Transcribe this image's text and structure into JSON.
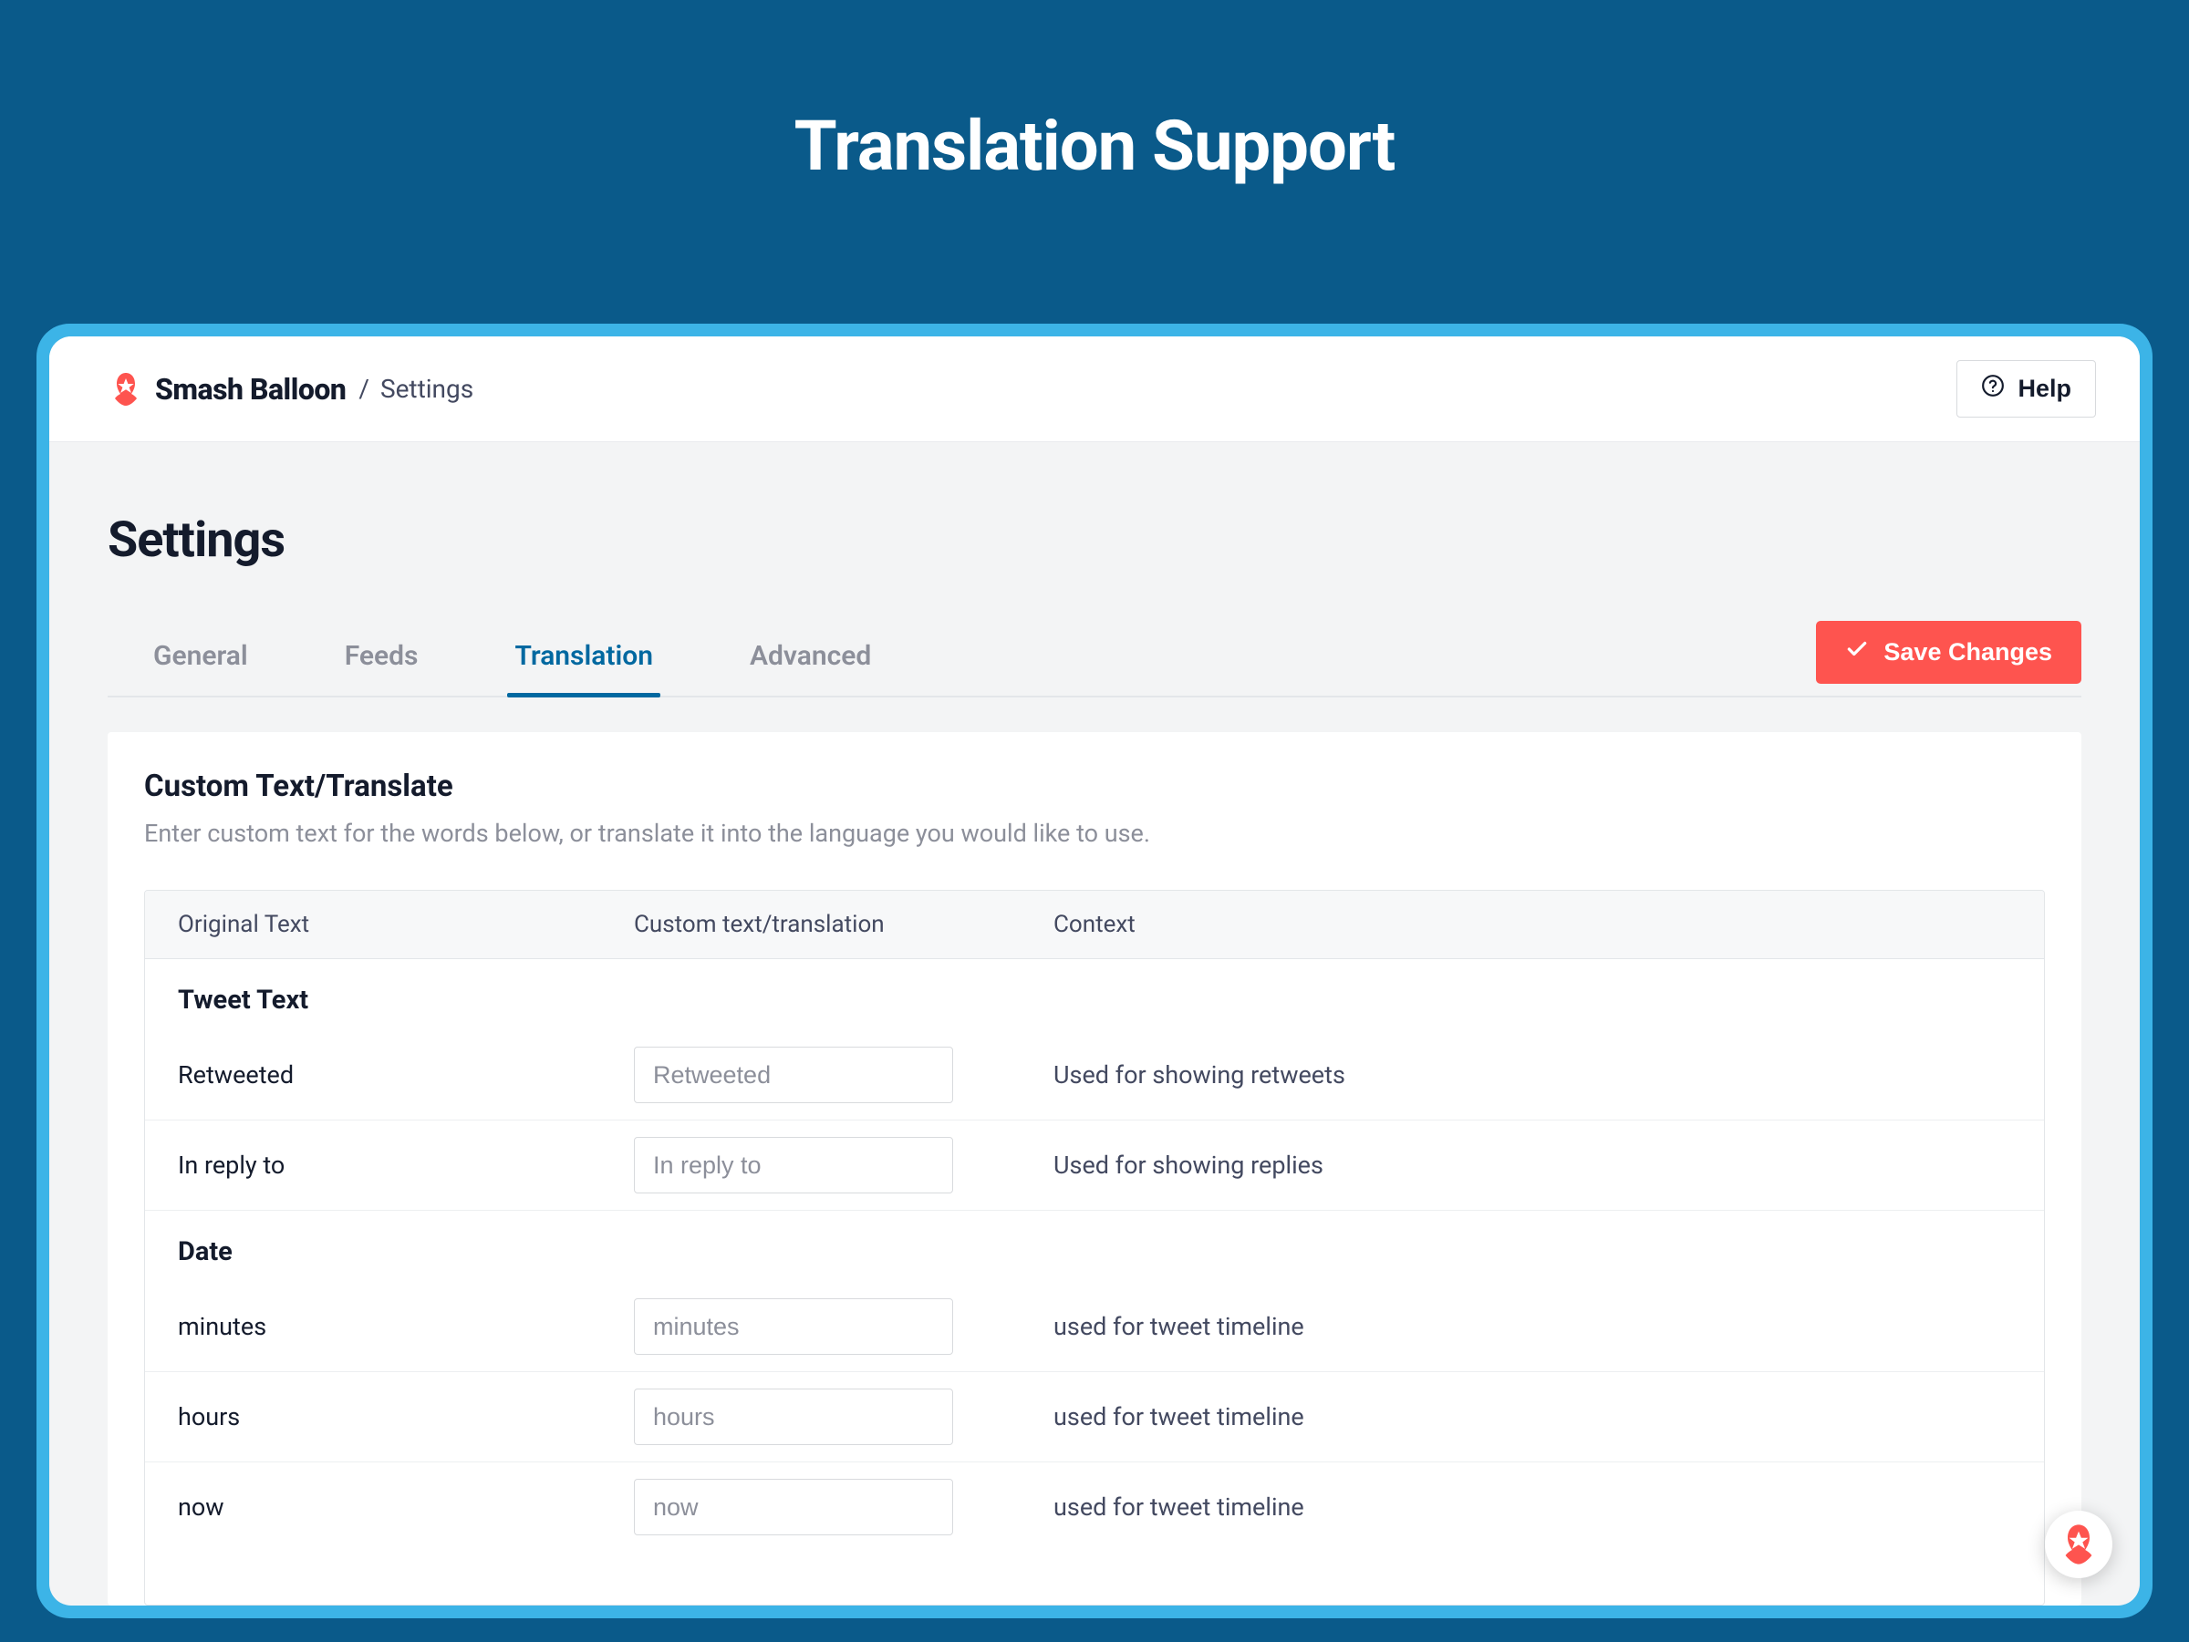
{
  "hero": {
    "title": "Translation Support"
  },
  "header": {
    "brand": "Smash Balloon",
    "breadcrumb_sep": "/",
    "breadcrumb_current": "Settings",
    "help_label": "Help"
  },
  "page": {
    "title": "Settings"
  },
  "tabs": {
    "items": [
      {
        "label": "General",
        "active": false
      },
      {
        "label": "Feeds",
        "active": false
      },
      {
        "label": "Translation",
        "active": true
      },
      {
        "label": "Advanced",
        "active": false
      }
    ],
    "save_label": "Save Changes"
  },
  "panel": {
    "title": "Custom Text/Translate",
    "description": "Enter custom text for the words below, or translate it into the language you would like to use."
  },
  "columns": {
    "original": "Original Text",
    "custom": "Custom text/translation",
    "context": "Context"
  },
  "sections": [
    {
      "title": "Tweet Text",
      "rows": [
        {
          "original": "Retweeted",
          "placeholder": "Retweeted",
          "value": "",
          "context": "Used for showing retweets"
        },
        {
          "original": "In reply to",
          "placeholder": "In reply to",
          "value": "",
          "context": "Used for showing replies"
        }
      ]
    },
    {
      "title": "Date",
      "rows": [
        {
          "original": "minutes",
          "placeholder": "minutes",
          "value": "",
          "context": "used for tweet timeline"
        },
        {
          "original": "hours",
          "placeholder": "hours",
          "value": "",
          "context": "used for tweet timeline"
        },
        {
          "original": "now",
          "placeholder": "now",
          "value": "",
          "context": "used for tweet timeline"
        }
      ]
    }
  ],
  "colors": {
    "brand_red": "#fe544f",
    "brand_blue": "#0068a0",
    "bg_blue": "#0a5a8a",
    "frame_blue": "#3cb4e7"
  }
}
